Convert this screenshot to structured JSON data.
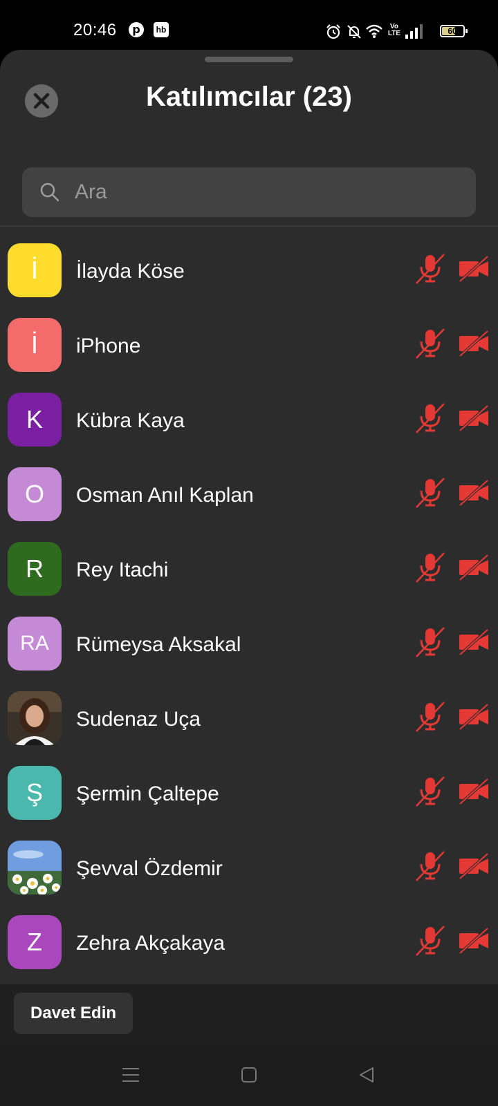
{
  "status_bar": {
    "time": "20:46",
    "app_icons": [
      "pinterest-icon",
      "hb-icon"
    ],
    "hb_label": "hb",
    "battery": "60",
    "network_label": "Vo LTE"
  },
  "header": {
    "title": "Katılımcılar (23)"
  },
  "search": {
    "placeholder": "Ara"
  },
  "participants": [
    {
      "initials": "İ",
      "name": "İlayda Köse",
      "color": "#fddc2e",
      "photo": false
    },
    {
      "initials": "İ",
      "name": "iPhone",
      "color": "#f46b6b",
      "photo": false
    },
    {
      "initials": "K",
      "name": "Kübra Kaya",
      "color": "#7b1fa2",
      "photo": false
    },
    {
      "initials": "O",
      "name": "Osman Anıl Kaplan",
      "color": "#c58ad6",
      "photo": false
    },
    {
      "initials": "R",
      "name": "Rey Itachi",
      "color": "#2e6b1f",
      "photo": false
    },
    {
      "initials": "RA",
      "name": "Rümeysa Aksakal",
      "color": "#c58ad6",
      "photo": false
    },
    {
      "initials": "",
      "name": "Sudenaz Uça",
      "color": "#2a2520",
      "photo": "portrait"
    },
    {
      "initials": "Ş",
      "name": "Şermin Çaltepe",
      "color": "#4bb8ae",
      "photo": false
    },
    {
      "initials": "",
      "name": "Şevval Özdemir",
      "color": "#5d8fd8",
      "photo": "flowers"
    },
    {
      "initials": "Z",
      "name": "Zehra Akçakaya",
      "color": "#ab47bc",
      "photo": false
    }
  ],
  "status_icons": {
    "mic": "mic-off-icon",
    "camera": "camera-off-icon",
    "color": "#e53935"
  },
  "footer": {
    "invite_label": "Davet Edin"
  }
}
